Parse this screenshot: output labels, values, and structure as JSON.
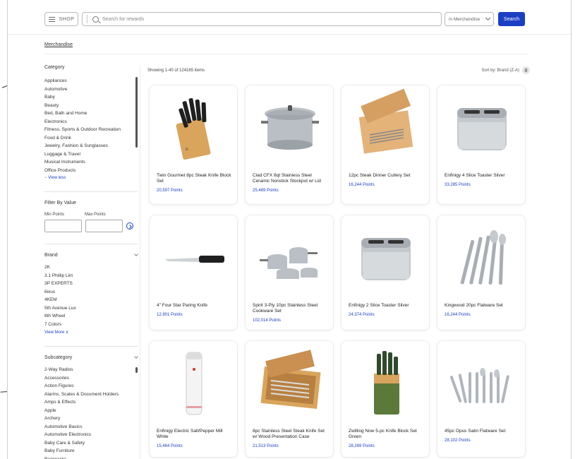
{
  "header": {
    "shop_label": "SHOP",
    "search_placeholder": "Search for rewards",
    "category_select": "in Merchandise",
    "search_button": "Search"
  },
  "breadcrumb": "Merchandise",
  "sidebar": {
    "category": {
      "title": "Category",
      "items": [
        "Appliances",
        "Automotive",
        "Baby",
        "Beauty",
        "Bed, Bath and Home",
        "Electronics",
        "Fitness, Sports & Outdoor Recreation",
        "Food & Drink",
        "Jewelry, Fashion & Sunglasses",
        "Luggage & Travel",
        "Musical Instruments",
        "Office Products"
      ],
      "view_less": "− View less"
    },
    "filter_value": {
      "title": "Filter By Value",
      "min_label": "Min Points",
      "max_label": "Max Points"
    },
    "brand": {
      "title": "Brand",
      "items": [
        "2K",
        "3.1 Phillip Lim",
        "3P EXPERTS",
        "6ixus",
        "4KEM",
        "5th Avenue Lux",
        "6th Wheel",
        "7 Colors"
      ],
      "view_more": "View More ∨"
    },
    "subcategory": {
      "title": "Subcategory",
      "items": [
        "2-Way Radios",
        "Accessories",
        "Action Figures",
        "Alarms, Scales & Document Holders",
        "Amps & Effects",
        "Apple",
        "Archery",
        "Automotive Basics",
        "Automotive Electronics",
        "Baby Care & Safety",
        "Baby Furniture",
        "Backpacks"
      ]
    }
  },
  "results": {
    "showing": "Showing 1-40 of 124165 items",
    "sort_label": "Sort by: Brand (Z-A)"
  },
  "products": [
    {
      "name": "Twin Gourmet 8pc Steak Knife Block Set",
      "points": "20,597 Points",
      "icon": "knife-block-icon"
    },
    {
      "name": "Clad CFX 8qt Stainless Steel Ceramic Nonstick Stockpot w/ Lid",
      "points": "25,469 Points",
      "icon": "stockpot-icon"
    },
    {
      "name": "12pc Steak Dinner Cutlery Set",
      "points": "16,244 Points",
      "icon": "cutlery-box-icon"
    },
    {
      "name": "Enfinigy 4 Slice Toaster Silver",
      "points": "33,285 Points",
      "icon": "toaster-icon"
    },
    {
      "name": "4\" Four Star Paring Knife",
      "points": "12,901 Points",
      "icon": "paring-knife-icon"
    },
    {
      "name": "Spirit 3-Ply 10pc Stainless Steel Cookware Set",
      "points": "102,014 Points",
      "icon": "cookware-set-icon"
    },
    {
      "name": "Enfinigy 2 Slice Toaster Silver",
      "points": "24,374 Points",
      "icon": "toaster-icon"
    },
    {
      "name": "Kingwood 20pc Flatware Set",
      "points": "16,244 Points",
      "icon": "flatware-icon"
    },
    {
      "name": "Enfinigy Electric Salt/Pepper Mill White",
      "points": "15,464 Points",
      "icon": "pepper-mill-icon"
    },
    {
      "name": "8pc Stainless Steel Steak Knife Set w/ Wood Presentation Case",
      "points": "21,513 Points",
      "icon": "steak-knife-case-icon"
    },
    {
      "name": "Zwilling Now 5-pc Knife Block Set Green",
      "points": "28,269 Points",
      "icon": "green-knife-block-icon"
    },
    {
      "name": "45pc Opus Satin Flatware Set",
      "points": "28,102 Points",
      "icon": "flatware-set-icon"
    }
  ],
  "colors": {
    "accent": "#1b3fc4",
    "border": "#ececec",
    "text": "#2a2a2a"
  }
}
